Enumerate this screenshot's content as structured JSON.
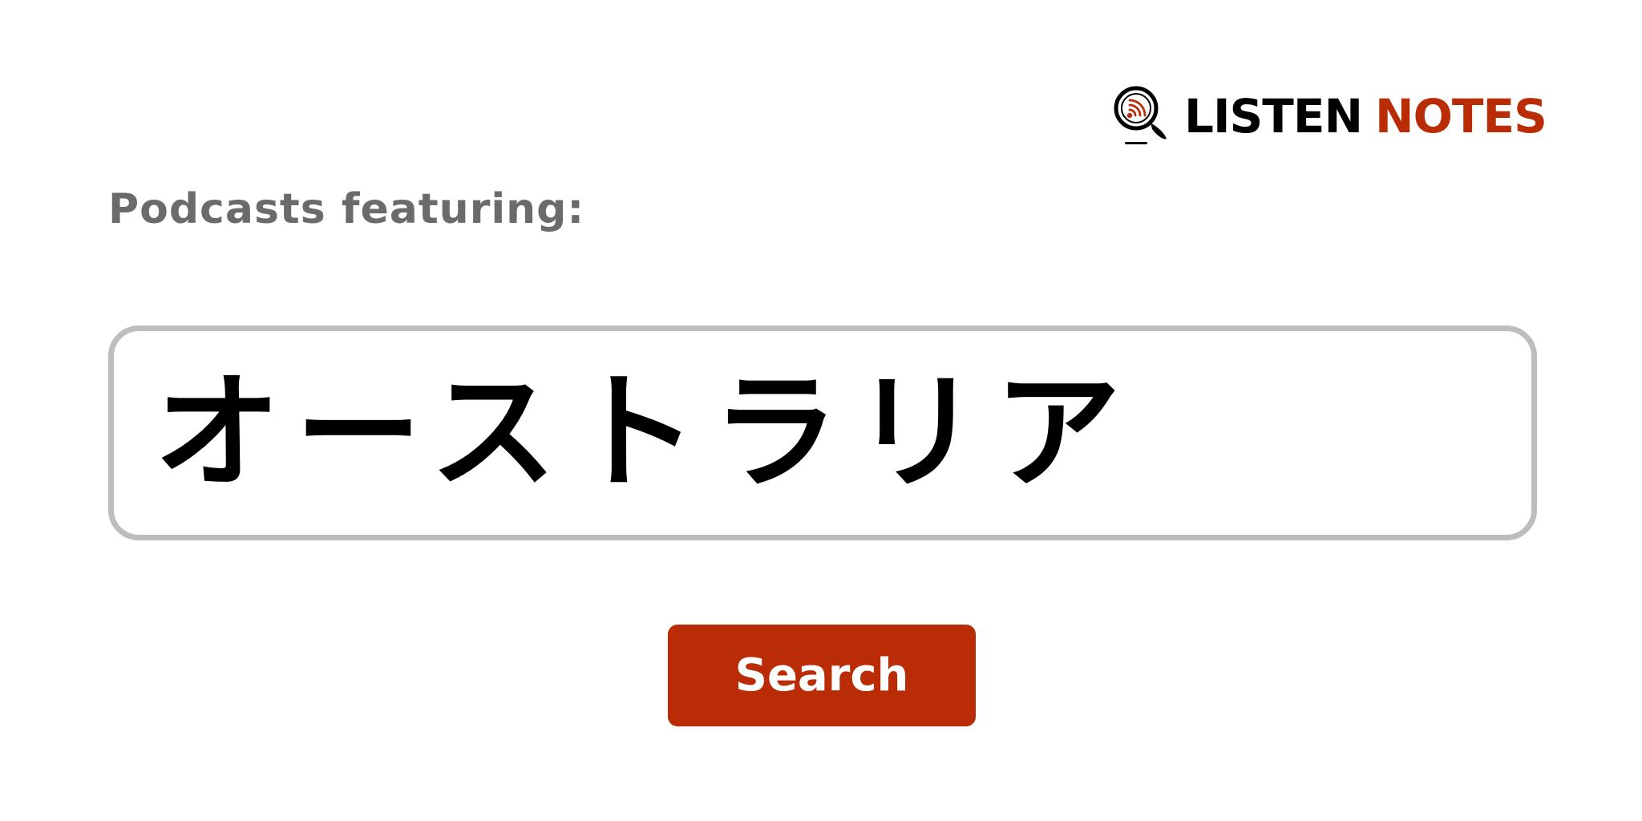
{
  "brand": {
    "logo_icon": "magnifier-podcast-icon",
    "word_listen": "LISTEN",
    "word_notes": "NOTES",
    "colors": {
      "listen": "#000000",
      "notes": "#b92c05"
    }
  },
  "heading": {
    "label": "Podcasts featuring:"
  },
  "query": {
    "value": "オーストラリア"
  },
  "search_button": {
    "label": "Search",
    "color": "#b92c05"
  },
  "colors": {
    "background": "#ffffff",
    "heading_text": "#6b6b6b",
    "box_border": "#bdbdbd"
  }
}
